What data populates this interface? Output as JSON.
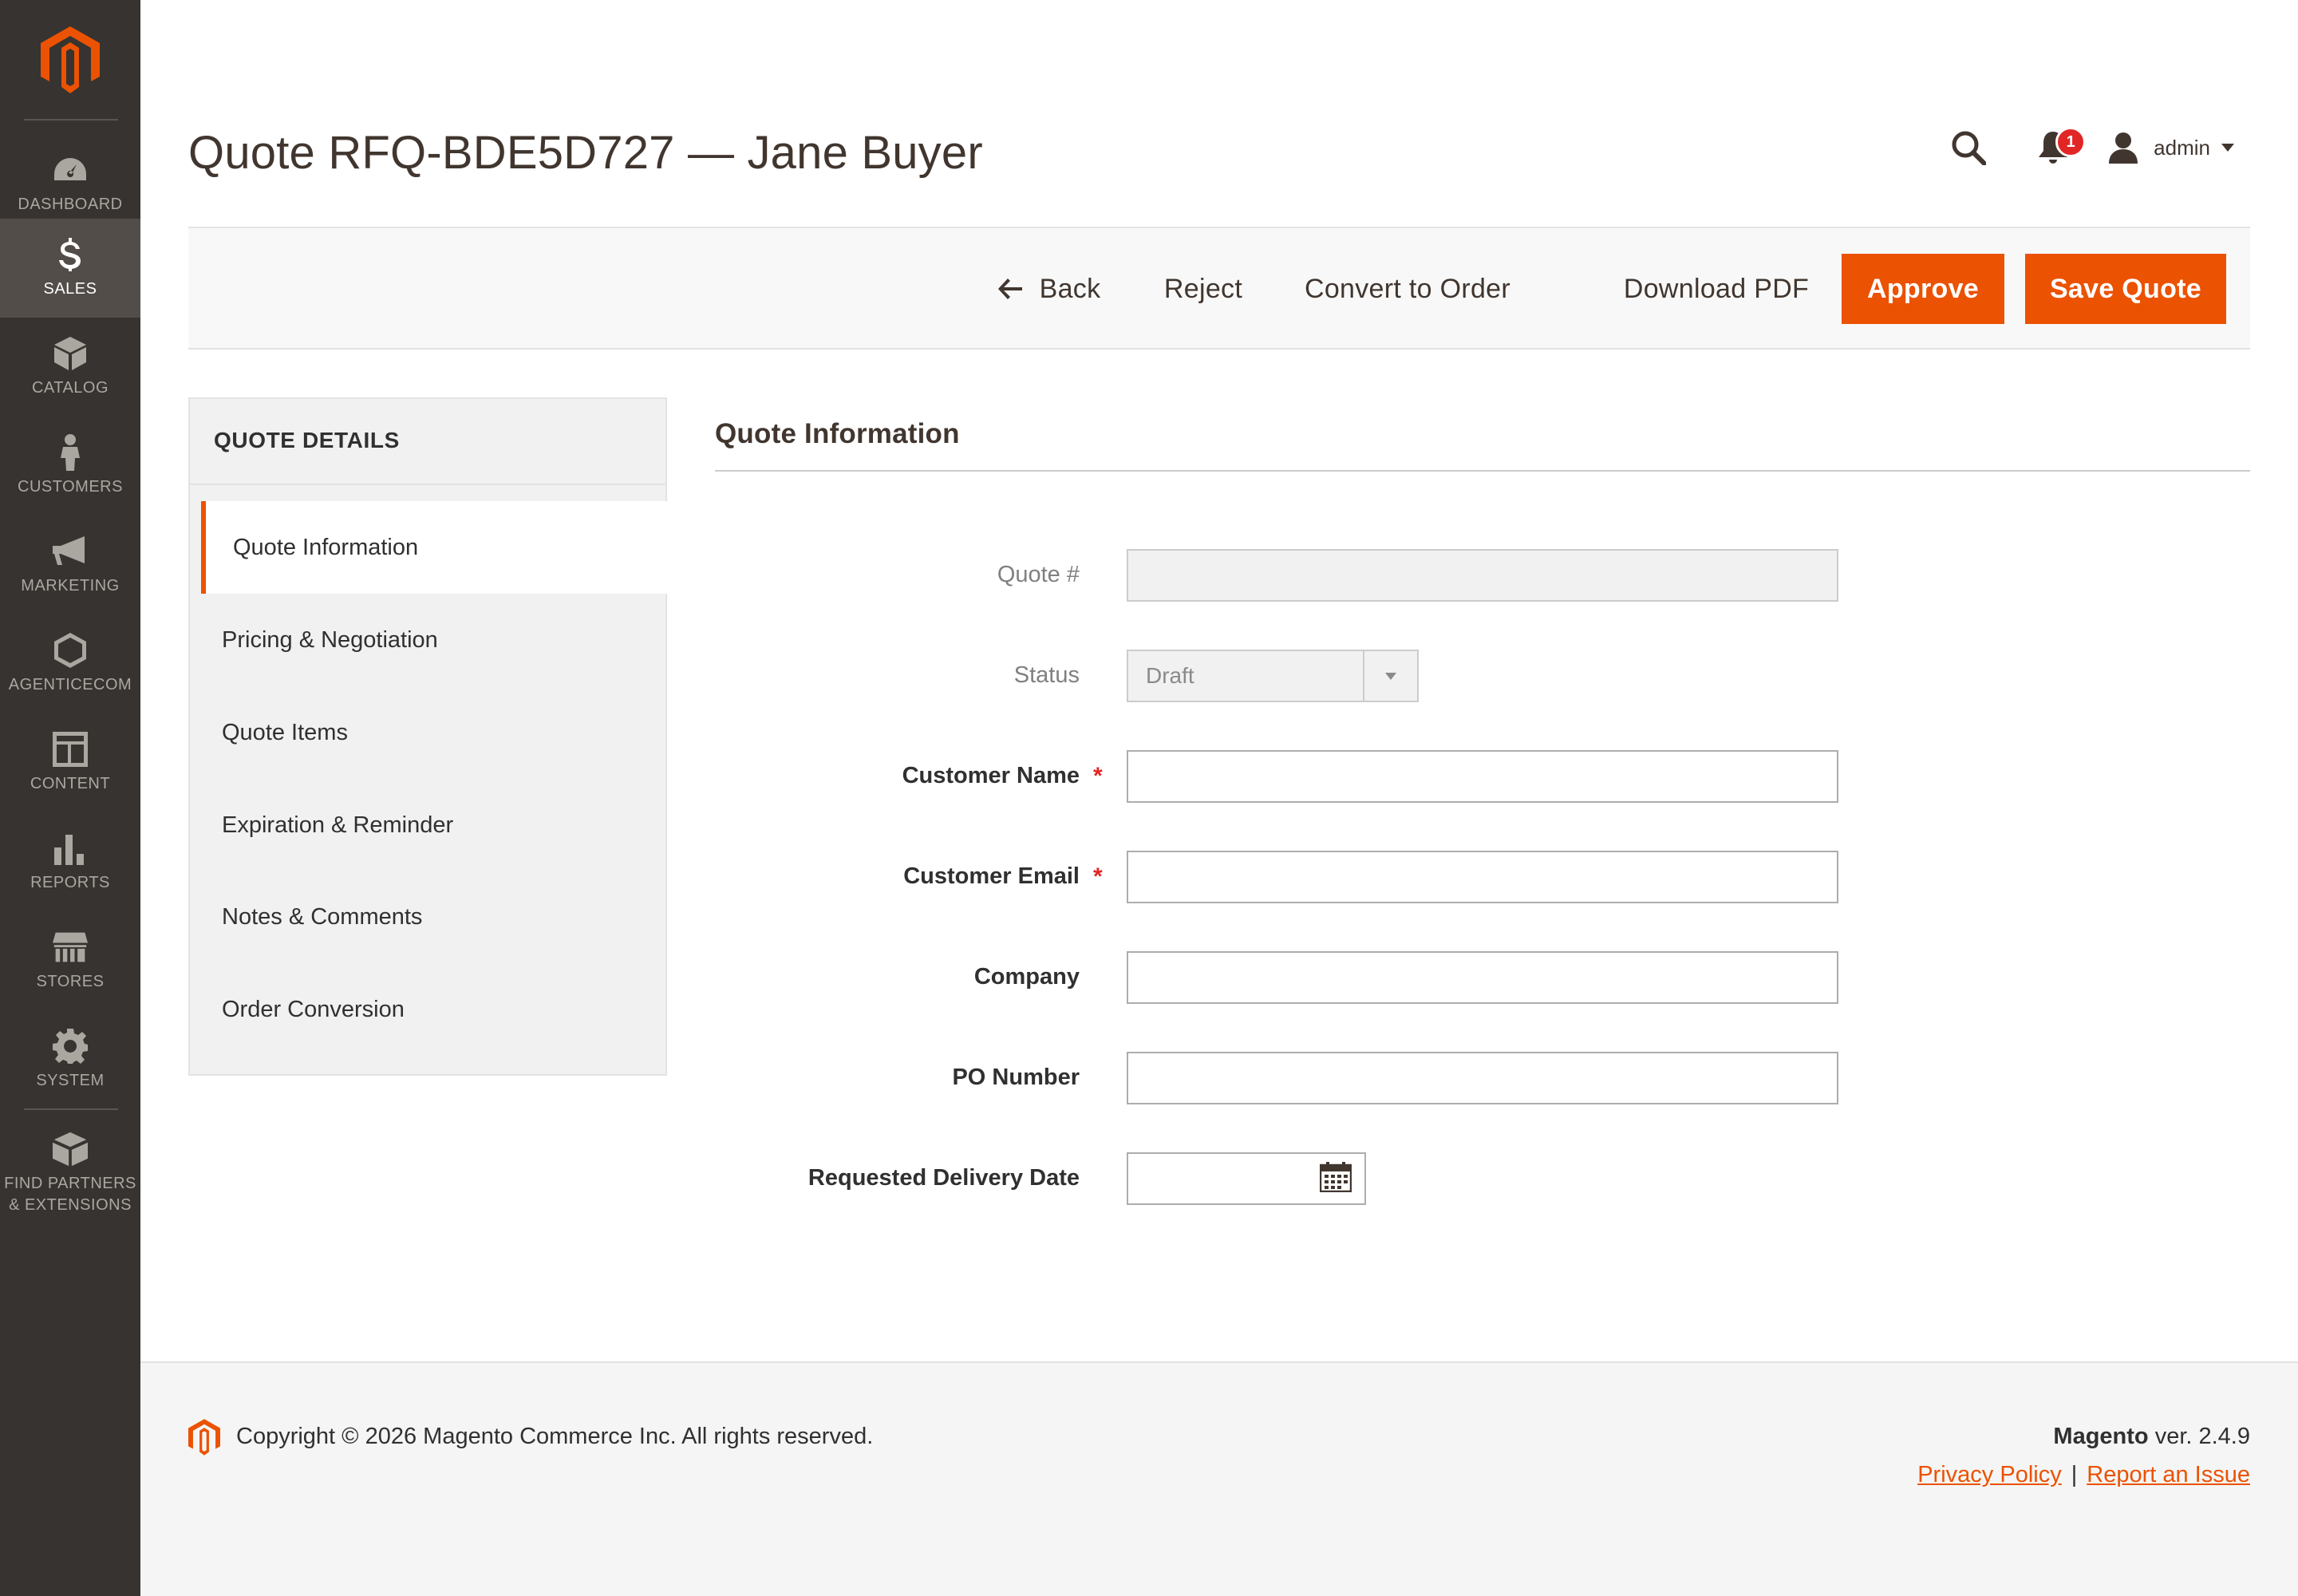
{
  "sidebar": {
    "logo": "magento-logo",
    "items": [
      {
        "label": "DASHBOARD",
        "icon": "gauge-icon"
      },
      {
        "label": "SALES",
        "icon": "dollar-icon"
      },
      {
        "label": "CATALOG",
        "icon": "cube-icon"
      },
      {
        "label": "CUSTOMERS",
        "icon": "person-icon"
      },
      {
        "label": "MARKETING",
        "icon": "megaphone-icon"
      },
      {
        "label": "AGENTICECOM",
        "icon": "hexagon-icon"
      },
      {
        "label": "CONTENT",
        "icon": "layout-icon"
      },
      {
        "label": "REPORTS",
        "icon": "bar-chart-icon"
      },
      {
        "label": "STORES",
        "icon": "storefront-icon"
      },
      {
        "label": "SYSTEM",
        "icon": "gear-icon"
      },
      {
        "label": "FIND PARTNERS\n& EXTENSIONS",
        "icon": "boxes-icon"
      }
    ],
    "active_index": 1
  },
  "header": {
    "title": "Quote RFQ-BDE5D727 — Jane Buyer",
    "notification_count": "1",
    "user_name": "admin"
  },
  "toolbar": {
    "back_label": "Back",
    "reject_label": "Reject",
    "convert_label": "Convert to Order",
    "download_label": "Download PDF",
    "approve_label": "Approve",
    "save_label": "Save Quote"
  },
  "tabs": {
    "title": "QUOTE DETAILS",
    "items": [
      {
        "label": "Quote Information"
      },
      {
        "label": "Pricing & Negotiation"
      },
      {
        "label": "Quote Items"
      },
      {
        "label": "Expiration & Reminder"
      },
      {
        "label": "Notes & Comments"
      },
      {
        "label": "Order Conversion"
      }
    ],
    "active_index": 0
  },
  "form": {
    "section_title": "Quote Information",
    "fields": {
      "quote_number": {
        "label": "Quote #",
        "value": ""
      },
      "status": {
        "label": "Status",
        "value": "Draft"
      },
      "customer_name": {
        "label": "Customer Name",
        "value": "",
        "required": "*"
      },
      "customer_email": {
        "label": "Customer Email",
        "value": "",
        "required": "*"
      },
      "company": {
        "label": "Company",
        "value": ""
      },
      "po_number": {
        "label": "PO Number",
        "value": ""
      },
      "delivery_date": {
        "label": "Requested Delivery Date",
        "value": ""
      }
    }
  },
  "footer": {
    "copyright": "Copyright © 2026 Magento Commerce Inc. All rights reserved.",
    "brand": "Magento",
    "version": " ver. 2.4.9",
    "privacy_link": "Privacy Policy",
    "separator": "|",
    "report_link": "Report an Issue"
  },
  "colors": {
    "accent": "#eb5202",
    "sidebar_bg": "#373330",
    "sidebar_active_bg": "#524d49",
    "required": "#e22626"
  }
}
